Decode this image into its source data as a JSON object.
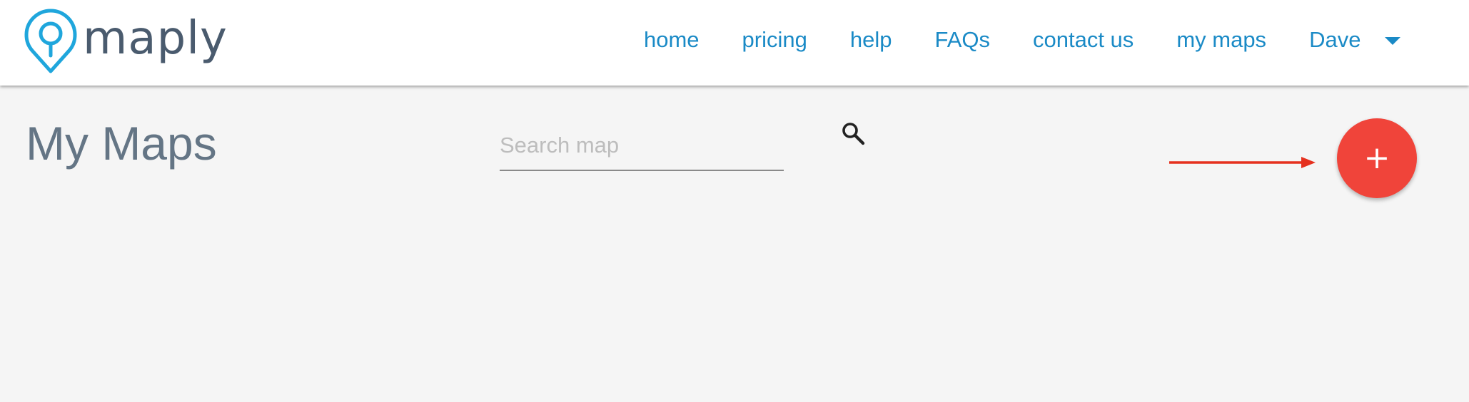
{
  "header": {
    "logo_text": "maply",
    "nav": {
      "home": "home",
      "pricing": "pricing",
      "help": "help",
      "faqs": "FAQs",
      "contact": "contact us",
      "my_maps": "my maps",
      "user": "Dave"
    }
  },
  "main": {
    "title": "My Maps",
    "search": {
      "placeholder": "Search map",
      "value": ""
    },
    "add_button": {
      "label": "+"
    }
  },
  "icons": {
    "logo": "map-pin-logo-icon",
    "search": "search-icon",
    "user_menu": "caret-down-icon",
    "annotation": "arrow-right-icon"
  },
  "colors": {
    "brand_blue": "#1a8ac6",
    "logo_text": "#4a5b6e",
    "title": "#647585",
    "fab": "#f0443a",
    "annotation_arrow": "#e5311f",
    "background": "#f5f5f5"
  }
}
